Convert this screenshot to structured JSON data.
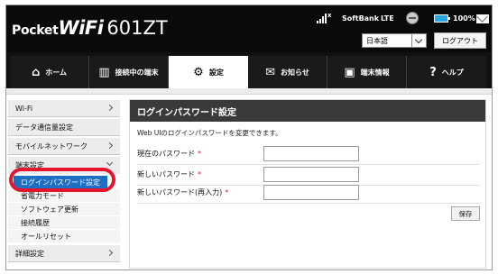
{
  "header": {
    "logo_part1": "Pocket",
    "logo_part2": "WiFi",
    "logo_part3": "601ZT",
    "signal_suffix": "x",
    "carrier": "SoftBank",
    "network": "LTE",
    "battery_percent": "100%",
    "language_selected": "日本語",
    "logout_label": "ログアウト"
  },
  "tabs": [
    {
      "label": "ホーム",
      "icon": "home-icon",
      "glyph": "⌂",
      "active": false
    },
    {
      "label": "接続中の端末",
      "icon": "devices-icon",
      "glyph": "▥",
      "active": false
    },
    {
      "label": "設定",
      "icon": "gear-icon",
      "glyph": "⚙",
      "active": true
    },
    {
      "label": "お知らせ",
      "icon": "mail-icon",
      "glyph": "✉",
      "active": false
    },
    {
      "label": "端末情報",
      "icon": "device-info-icon",
      "glyph": "▣",
      "active": false
    },
    {
      "label": "ヘルプ",
      "icon": "help-icon",
      "glyph": "?",
      "active": false
    }
  ],
  "sidebar": {
    "items": [
      {
        "label": "Wi-Fi"
      },
      {
        "label": "データ通信量設定"
      },
      {
        "label": "モバイルネットワーク"
      },
      {
        "label": "端末設定"
      }
    ],
    "submenu": [
      {
        "label": "ログインパスワード設定",
        "active": true
      },
      {
        "label": "省電力モード"
      },
      {
        "label": "ソフトウェア更新"
      },
      {
        "label": "接続履歴"
      },
      {
        "label": "オールリセット"
      }
    ],
    "bottom_item": {
      "label": "詳細設定"
    }
  },
  "main": {
    "title": "ログインパスワード設定",
    "description": "Web UIのログインパスワードを変更できます。",
    "fields": [
      {
        "label": "現在のパスワード",
        "required": "*",
        "value": ""
      },
      {
        "label": "新しいパスワード",
        "required": "*",
        "value": ""
      },
      {
        "label": "新しいパスワード(再入力)",
        "required": "*",
        "value": ""
      }
    ],
    "save_label": "保存"
  },
  "colors": {
    "header_bg": "#0a0a0a",
    "active_submenu": "#1e6fc4",
    "highlight_ring": "#e4152d",
    "title_bar": "#3a3a3a",
    "battery": "#2aa7dd"
  }
}
